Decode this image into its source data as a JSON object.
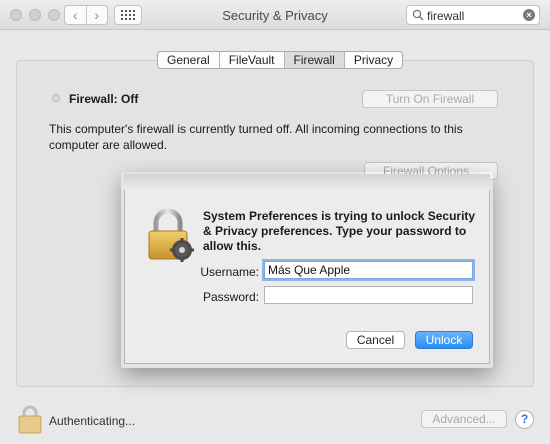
{
  "window": {
    "title": "Security & Privacy"
  },
  "toolbar": {
    "back_glyph": "‹",
    "forward_glyph": "›",
    "grid_icon": "grid-icon",
    "search": {
      "value": "firewall",
      "icon": "search-icon",
      "clear_icon": "clear-icon",
      "clear_glyph": "×"
    }
  },
  "tabs": [
    {
      "label": "General"
    },
    {
      "label": "FileVault"
    },
    {
      "label": "Firewall"
    },
    {
      "label": "Privacy"
    }
  ],
  "active_tab": "Firewall",
  "firewall": {
    "status": "Firewall: Off",
    "turn_on_label": "Turn On Firewall",
    "description": "This computer's firewall is currently turned off. All incoming connections to this computer are allowed.",
    "options_label": "Firewall Options..."
  },
  "dialog": {
    "message": "System Preferences is trying to unlock Security & Privacy preferences. Type your password to allow this.",
    "username_label": "Username:",
    "username_value": "Más Que Apple",
    "password_label": "Password:",
    "password_value": "",
    "cancel_label": "Cancel",
    "unlock_label": "Unlock"
  },
  "footer": {
    "auth_text": "Authenticating...",
    "advanced_label": "Advanced...",
    "help_glyph": "?"
  },
  "colors": {
    "accent": "#2a8cf7",
    "background": "#e8e8e8"
  }
}
